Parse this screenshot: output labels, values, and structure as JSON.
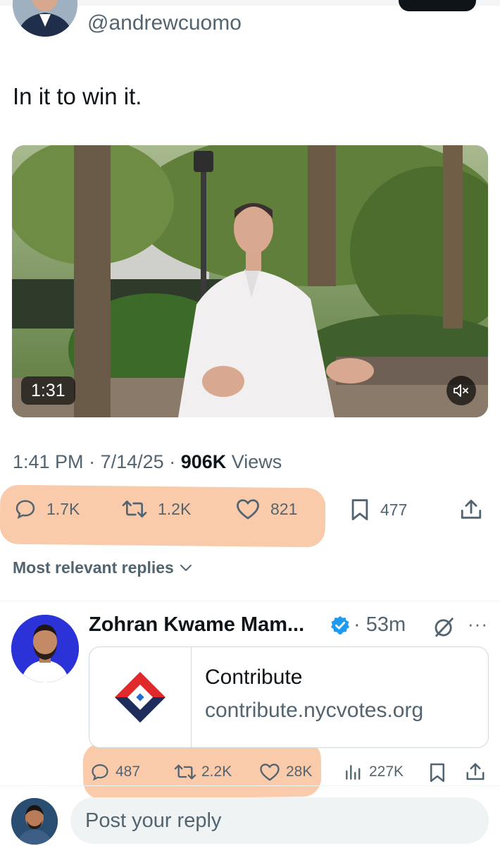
{
  "author": {
    "handle": "@andrewcuomo",
    "tweet_text": "In it to win it."
  },
  "video": {
    "duration": "1:31",
    "mute_icon": "volume-muted-icon"
  },
  "meta": {
    "time": "1:41 PM",
    "date": "7/14/25",
    "views_count": "906K",
    "views_label": "Views"
  },
  "actions": {
    "replies": "1.7K",
    "reposts": "1.2K",
    "likes": "821",
    "bookmarks": "477"
  },
  "replies_sort": {
    "label": "Most relevant replies"
  },
  "reply": {
    "name": "Zohran Kwame Mam...",
    "time": "53m",
    "verified_color": "#1d9bf0",
    "card": {
      "title": "Contribute",
      "domain": "contribute.nycvotes.org"
    },
    "stats": {
      "replies": "487",
      "reposts": "2.2K",
      "likes": "28K",
      "views": "227K"
    }
  },
  "compose": {
    "placeholder": "Post your reply"
  },
  "colors": {
    "text": "#0f1419",
    "secondary": "#536471",
    "highlight": "#f8b98f",
    "accent": "#1d9bf0"
  }
}
